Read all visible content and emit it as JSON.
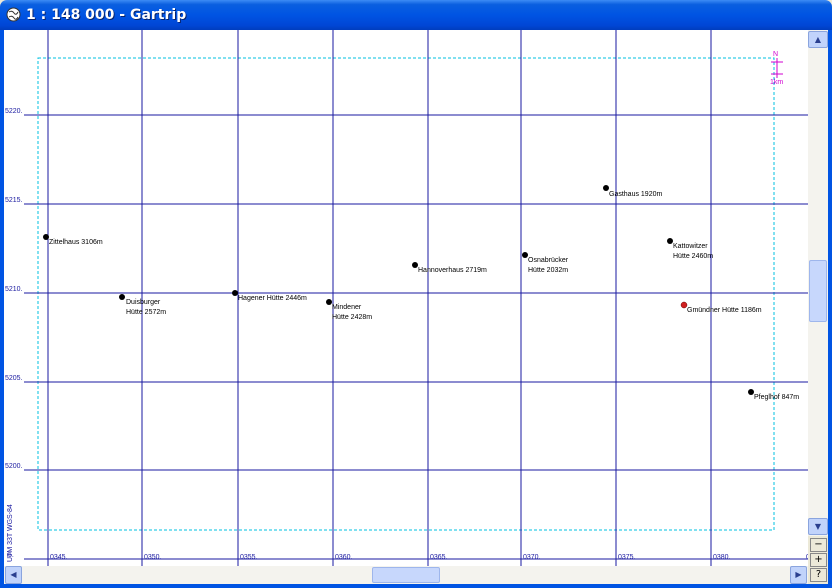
{
  "window": {
    "title": "1 : 148 000 - Gartrip"
  },
  "map": {
    "northing_ticks": [
      "5220.",
      "5215.",
      "5210.",
      "5205.",
      "5200."
    ],
    "easting_ticks": [
      "0345.",
      "0350.",
      "0355.",
      "0360.",
      "0365.",
      "0370.",
      "0375.",
      "0380."
    ],
    "corner_tick_y": "5.",
    "corner_tick_x": "0.",
    "crs_label": "UTM 33T WGS-84",
    "north_arrow": {
      "n": "N",
      "scale": "1km"
    },
    "huts": [
      {
        "lines": [
          "Zittelhaus 3106m"
        ]
      },
      {
        "lines": [
          "Duisburger",
          "Hütte 2572m"
        ]
      },
      {
        "lines": [
          "Hagener Hütte 2446m"
        ]
      },
      {
        "lines": [
          "Mindener",
          "Hütte 2428m"
        ]
      },
      {
        "lines": [
          "Hannoverhaus 2719m"
        ]
      },
      {
        "lines": [
          "Osnabrücker",
          "Hütte 2032m"
        ]
      },
      {
        "lines": [
          "Gasthaus 1920m"
        ]
      },
      {
        "lines": [
          "Kattowitzer",
          "Hütte 2460m"
        ]
      },
      {
        "lines": [
          "Gmündner Hütte 1186m"
        ],
        "highlight": true
      },
      {
        "lines": [
          "Pfeglhof 847m"
        ]
      }
    ]
  },
  "colors": {
    "grid": "#1a1aa0",
    "boundary": "#00c0e0",
    "marker": "#000000",
    "highlight": "#d02020",
    "north": "#d000d0"
  },
  "tools": {
    "zoom_out": "−",
    "zoom_in": "+",
    "help": "?"
  }
}
